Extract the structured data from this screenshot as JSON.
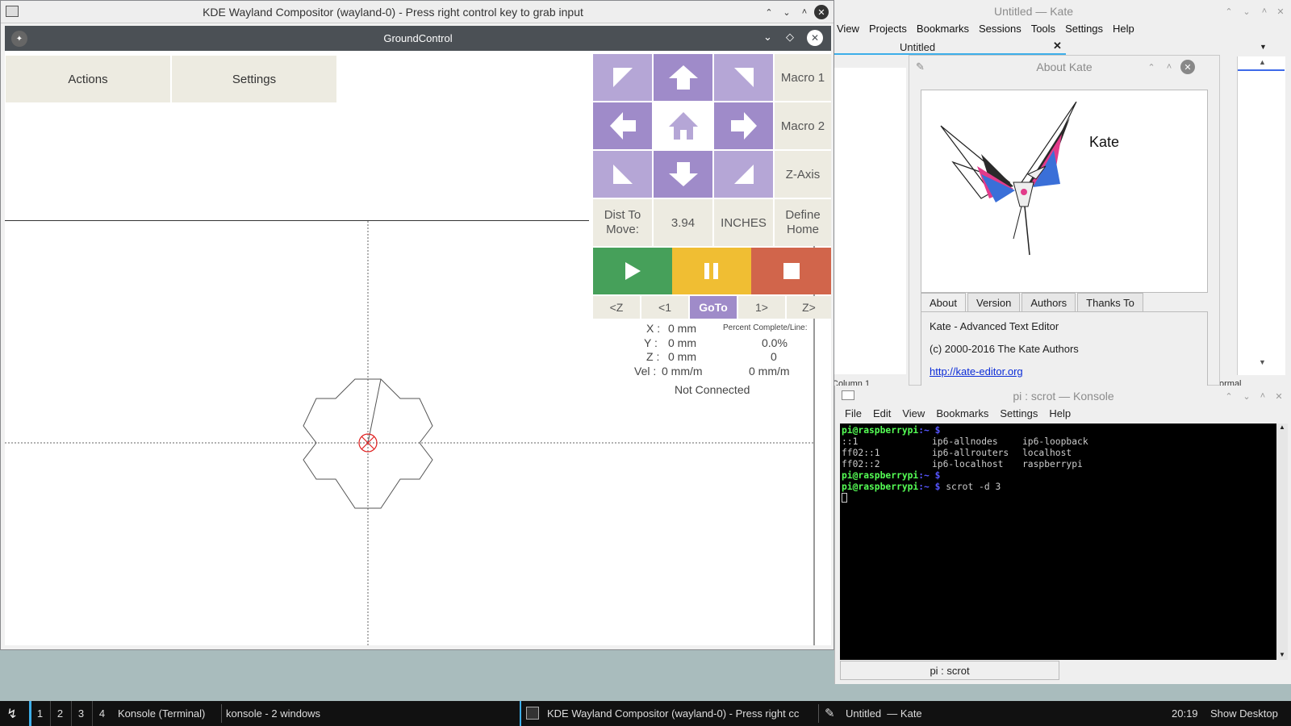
{
  "wayland": {
    "title": "KDE Wayland Compositor (wayland-0) - Press right control key to grab input"
  },
  "groundcontrol": {
    "title": "GroundControl",
    "top_buttons": {
      "actions": "Actions",
      "settings": "Settings"
    },
    "side_buttons": {
      "macro1": "Macro 1",
      "macro2": "Macro 2",
      "zaxis": "Z-Axis",
      "define_home": "Define Home"
    },
    "dist": {
      "label": "Dist To Move:",
      "value": "3.94",
      "units": "INCHES"
    },
    "goto_tabs": [
      "<Z",
      "<1",
      "GoTo",
      "1>",
      "Z>"
    ],
    "readout": {
      "x_label": "X :",
      "x_value": "0 mm",
      "y_label": "Y :",
      "y_value": "0 mm",
      "z_label": "Z :",
      "z_value": "0 mm",
      "vel_label": "Vel :",
      "vel_value": "0 mm/m",
      "percent_label": "Percent Complete/Line:",
      "percent_value": "0.0%",
      "line_value": "0",
      "speed_value": "0 mm/m",
      "status": "Not Connected"
    },
    "colors": {
      "play": "#46a05a",
      "pause": "#f0be33",
      "stop": "#d1654b",
      "pad_light": "#b5a6d6",
      "pad_dark": "#9f8bc9",
      "goto_active": "#9f8bc9"
    }
  },
  "kate": {
    "title": "Untitled — Kate",
    "menu": [
      "View",
      "Projects",
      "Bookmarks",
      "Sessions",
      "Tools",
      "Settings",
      "Help"
    ],
    "tab": "Untitled",
    "status_left": "Column 1",
    "status_right": "ormal"
  },
  "about": {
    "title": "About Kate",
    "app_name": "Kate",
    "tabs": [
      "About",
      "Version",
      "Authors",
      "Thanks To"
    ],
    "description": "Kate - Advanced Text Editor",
    "copyright": "(c) 2000-2016 The Kate Authors",
    "link": "http://kate-editor.org"
  },
  "konsole": {
    "title": "pi : scrot — Konsole",
    "menu": [
      "File",
      "Edit",
      "View",
      "Bookmarks",
      "Settings",
      "Help"
    ],
    "prompt": "pi@raspberrypi",
    "prompt_suffix": ":~",
    "output_rows": [
      [
        "::1",
        "ip6-allnodes",
        "ip6-loopback"
      ],
      [
        "ff02::1",
        "ip6-allrouters",
        "localhost"
      ],
      [
        "ff02::2",
        "ip6-localhost",
        "raspberrypi"
      ]
    ],
    "command": "scrot -d 3",
    "tab": "pi : scrot"
  },
  "taskbar": {
    "desktops": [
      "1",
      "2",
      "3",
      "4"
    ],
    "tasks": [
      "Konsole (Terminal)",
      "konsole - 2 windows",
      "KDE Wayland Compositor (wayland-0) - Press right cc",
      "Untitled  — Kate"
    ],
    "clock": "20:19",
    "show_desktop": "Show Desktop"
  }
}
